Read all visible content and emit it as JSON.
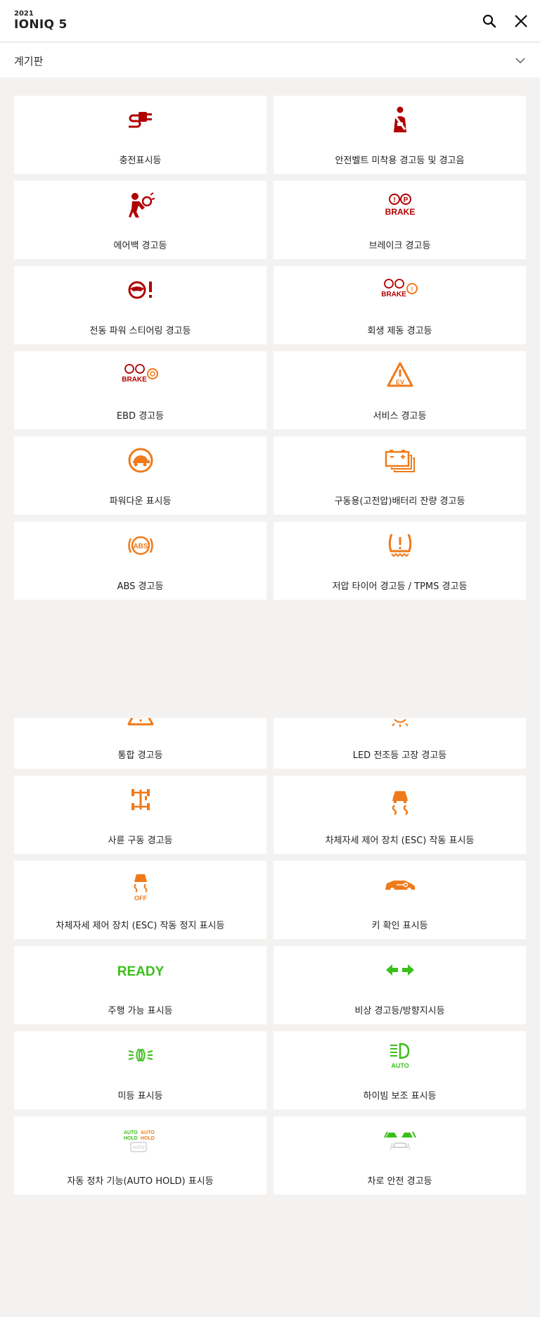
{
  "header": {
    "year": "2021",
    "model": "IONIQ 5"
  },
  "selector": {
    "value": "계기판"
  },
  "cards": [
    {
      "label": "충전표시등",
      "icon": "charging-plug-icon",
      "color": "#b00000"
    },
    {
      "label": "안전벨트 미착용 경고등 및 경고음",
      "icon": "seatbelt-icon",
      "color": "#b00000"
    },
    {
      "label": "에어백 경고등",
      "icon": "airbag-icon",
      "color": "#b00000"
    },
    {
      "label": "브레이크 경고등",
      "icon": "brake-icon",
      "color": "#b00000",
      "icon_text": "BRAKE"
    },
    {
      "label": "전동 파워 스티어링 경고등",
      "icon": "steering-warning-icon",
      "color": "#b00000"
    },
    {
      "label": "회생 제동 경고등",
      "icon": "regen-brake-icon",
      "color": "#b00000",
      "icon_text": "BRAKE"
    },
    {
      "label": "EBD 경고등",
      "icon": "ebd-brake-icon",
      "color": "#b00000",
      "icon_text": "BRAKE"
    },
    {
      "label": "서비스 경고등",
      "icon": "ev-service-triangle-icon",
      "color": "#f07a1a",
      "icon_text": "EV"
    },
    {
      "label": "파워다운 표시등",
      "icon": "power-down-turtle-icon",
      "color": "#f07a1a"
    },
    {
      "label": "구동용(고전압)배터리 잔량 경고등",
      "icon": "battery-icon",
      "color": "#f07a1a"
    },
    {
      "label": "ABS 경고등",
      "icon": "abs-icon",
      "color": "#f07a1a",
      "icon_text": "ABS"
    },
    {
      "label": "저압 타이어 경고등 / TPMS 경고등",
      "icon": "tpms-icon",
      "color": "#f07a1a"
    },
    {
      "label": "통합 경고등",
      "icon": "master-warning-icon",
      "color": "#f07a1a"
    },
    {
      "label": "LED 전조등 고장 경고등",
      "icon": "led-headlamp-icon",
      "color": "#f07a1a"
    },
    {
      "label": "사륜 구동 경고등",
      "icon": "awd-icon",
      "color": "#f07a1a"
    },
    {
      "label": "차체자세 제어 장치 (ESC) 작동 표시등",
      "icon": "esc-icon",
      "color": "#f07a1a"
    },
    {
      "label": "차체자세 제어 장치 (ESC) 작동 정지 표시등",
      "icon": "esc-off-icon",
      "color": "#f07a1a",
      "icon_text": "OFF"
    },
    {
      "label": "키 확인 표시등",
      "icon": "car-key-icon",
      "color": "#f07a1a"
    },
    {
      "label": "주행 가능 표시등",
      "icon": "ready-icon",
      "color": "#3bbf1a",
      "icon_text": "READY"
    },
    {
      "label": "비상 경고등/방향지시등",
      "icon": "turn-signal-icon",
      "color": "#3bbf1a"
    },
    {
      "label": "미등 표시등",
      "icon": "position-lamp-icon",
      "color": "#3bbf1a"
    },
    {
      "label": "하이빔 보조 표시등",
      "icon": "high-beam-assist-icon",
      "color": "#3bbf1a",
      "icon_text": "AUTO"
    },
    {
      "label": "자동 정차 기능(AUTO HOLD) 표시등",
      "icon": "auto-hold-icon",
      "color": "#3bbf1a",
      "icon_text": "AUTO HOLD"
    },
    {
      "label": "차로 안전 경고등",
      "icon": "lane-safety-icon",
      "color": "#3bbf1a"
    }
  ]
}
